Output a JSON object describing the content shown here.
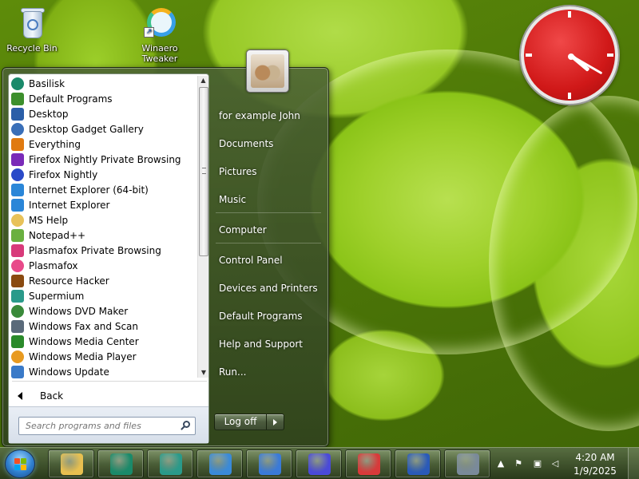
{
  "desktop": {
    "icons": [
      {
        "label": "Recycle Bin",
        "icon": "recycle-bin-icon"
      },
      {
        "label": "Winaero Tweaker",
        "icon": "winaero-tweaker-icon"
      }
    ]
  },
  "start_menu": {
    "programs": [
      {
        "label": "Basilisk",
        "icon": "basilisk-icon",
        "color": "#1a8a6a"
      },
      {
        "label": "Default Programs",
        "icon": "default-programs-icon",
        "color": "#3c8f2c"
      },
      {
        "label": "Desktop",
        "icon": "desktop-icon",
        "color": "#2a5ea8"
      },
      {
        "label": "Desktop Gadget Gallery",
        "icon": "gadget-gallery-icon",
        "color": "#3a6fb8"
      },
      {
        "label": "Everything",
        "icon": "everything-search-icon",
        "color": "#e07a10"
      },
      {
        "label": "Firefox Nightly Private Browsing",
        "icon": "firefox-private-icon",
        "color": "#7a2ab8"
      },
      {
        "label": "Firefox Nightly",
        "icon": "firefox-nightly-icon",
        "color": "#2a4ac8"
      },
      {
        "label": "Internet Explorer (64-bit)",
        "icon": "internet-explorer-icon",
        "color": "#2a86d8"
      },
      {
        "label": "Internet Explorer",
        "icon": "internet-explorer-icon",
        "color": "#2a86d8"
      },
      {
        "label": "MS Help",
        "icon": "folder-icon",
        "color": "#e8c25a"
      },
      {
        "label": "Notepad++",
        "icon": "notepad-plus-plus-icon",
        "color": "#6ab040"
      },
      {
        "label": "Plasmafox Private Browsing",
        "icon": "plasmafox-private-icon",
        "color": "#d83a7a"
      },
      {
        "label": "Plasmafox",
        "icon": "plasmafox-icon",
        "color": "#e84a8a"
      },
      {
        "label": "Resource Hacker",
        "icon": "resource-hacker-icon",
        "color": "#8a4a10"
      },
      {
        "label": "Supermium",
        "icon": "supermium-icon",
        "color": "#2a9a8a"
      },
      {
        "label": "Windows DVD Maker",
        "icon": "dvd-maker-icon",
        "color": "#3a8a3a"
      },
      {
        "label": "Windows Fax and Scan",
        "icon": "fax-scan-icon",
        "color": "#5a6a7a"
      },
      {
        "label": "Windows Media Center",
        "icon": "media-center-icon",
        "color": "#2a8a2a"
      },
      {
        "label": "Windows Media Player",
        "icon": "media-player-icon",
        "color": "#e89a20"
      },
      {
        "label": "Windows Update",
        "icon": "windows-update-icon",
        "color": "#3a7ac8"
      }
    ],
    "back_label": "Back",
    "search_placeholder": "Search programs and files",
    "right_items": [
      {
        "label": "for example John",
        "name": "user-name-link"
      },
      {
        "label": "Documents",
        "name": "documents-link"
      },
      {
        "label": "Pictures",
        "name": "pictures-link"
      },
      {
        "label": "Music",
        "name": "music-link"
      },
      {
        "label": "Computer",
        "name": "computer-link"
      },
      {
        "label": "Control Panel",
        "name": "control-panel-link"
      },
      {
        "label": "Devices and Printers",
        "name": "devices-printers-link"
      },
      {
        "label": "Default Programs",
        "name": "default-programs-link"
      },
      {
        "label": "Help and Support",
        "name": "help-support-link"
      },
      {
        "label": "Run...",
        "name": "run-link"
      }
    ],
    "logoff_label": "Log off"
  },
  "taskbar": {
    "buttons": [
      {
        "icon": "explorer-icon",
        "color": "#e8c050"
      },
      {
        "icon": "basilisk-icon",
        "color": "#1a8a6a"
      },
      {
        "icon": "supermium-icon",
        "color": "#2a9a8a"
      },
      {
        "icon": "control-panel-icon",
        "color": "#3a8ad8"
      },
      {
        "icon": "usb-drive-icon",
        "color": "#3a7ad8"
      },
      {
        "icon": "gear-icon",
        "color": "#4a4ad8"
      },
      {
        "icon": "resource-icon",
        "color": "#d83a3a"
      },
      {
        "icon": "word-icon",
        "color": "#2a5ab8"
      },
      {
        "icon": "media-icon",
        "color": "#7a8a9a"
      }
    ],
    "time": "4:20 AM",
    "date": "1/9/2025"
  },
  "colors": {
    "clock_face": "#d01818",
    "menu_glass": "#4a6034"
  }
}
